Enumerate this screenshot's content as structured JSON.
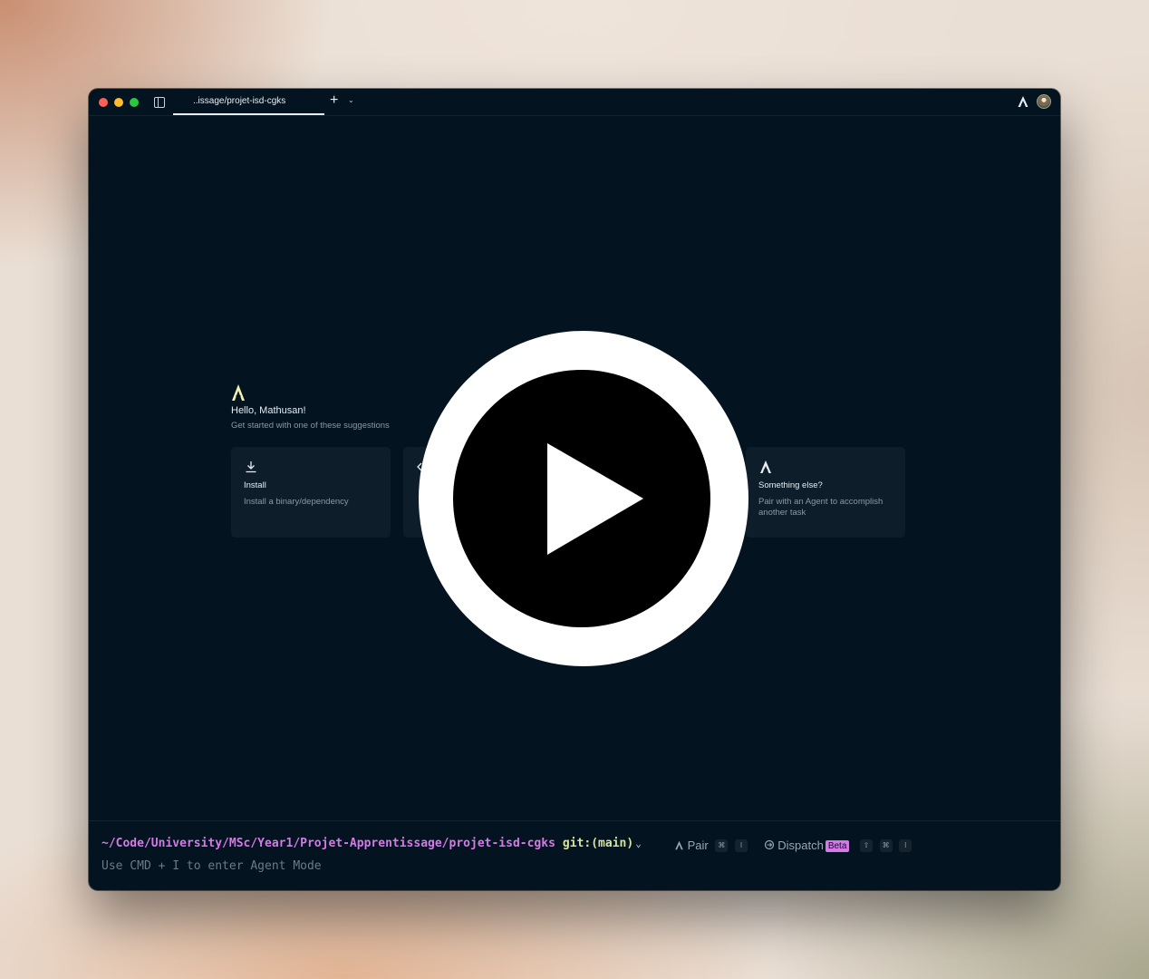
{
  "titlebar": {
    "tab_label": "..issage/projet-isd-cgks",
    "new_tab_glyph": "+",
    "tab_menu_glyph": "⌄"
  },
  "welcome": {
    "greeting": "Hello, Mathusan!",
    "subtitle": "Get started with one of these suggestions"
  },
  "cards": [
    {
      "icon": "download-icon",
      "title": "Install",
      "description": "Install a binary/dependency"
    },
    {
      "icon": "code-icon",
      "title": "",
      "description": ""
    },
    {
      "icon": "agent-logo-icon",
      "title": "Something else?",
      "description": "Pair with an Agent to accomplish another task"
    }
  ],
  "prompt": {
    "cwd": "~/Code/University/MSc/Year1/Projet-Apprentissage/projet-isd-cgks",
    "git": "git:(main)",
    "pair_label": "Pair",
    "pair_keys": [
      "⌘",
      "I"
    ],
    "dispatch_label": "Dispatch",
    "dispatch_badge": "Beta",
    "dispatch_keys": [
      "⇧",
      "⌘",
      "I"
    ],
    "hint": "Use CMD + I to enter Agent Mode"
  },
  "colors": {
    "window_bg": "#03131f",
    "card_bg": "#0d1e2a",
    "cwd": "#d37ae6",
    "git": "#d6e59a",
    "logo_accent": "#f3f0b4"
  },
  "overlay": {
    "icon": "play-button-icon"
  }
}
